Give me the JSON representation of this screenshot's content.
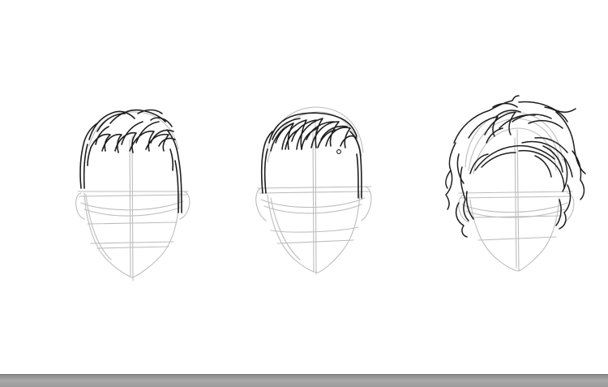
{
  "colors": {
    "canvas_background": "#ffffff",
    "guide_line": "#bdbdbd",
    "ink_line": "#1e1e1e",
    "bottom_bar": "#9e9e9e"
  },
  "sketches": [
    {
      "name": "short-textured-quiff"
    },
    {
      "name": "swept-pompadour"
    },
    {
      "name": "wavy-medium-length"
    }
  ]
}
